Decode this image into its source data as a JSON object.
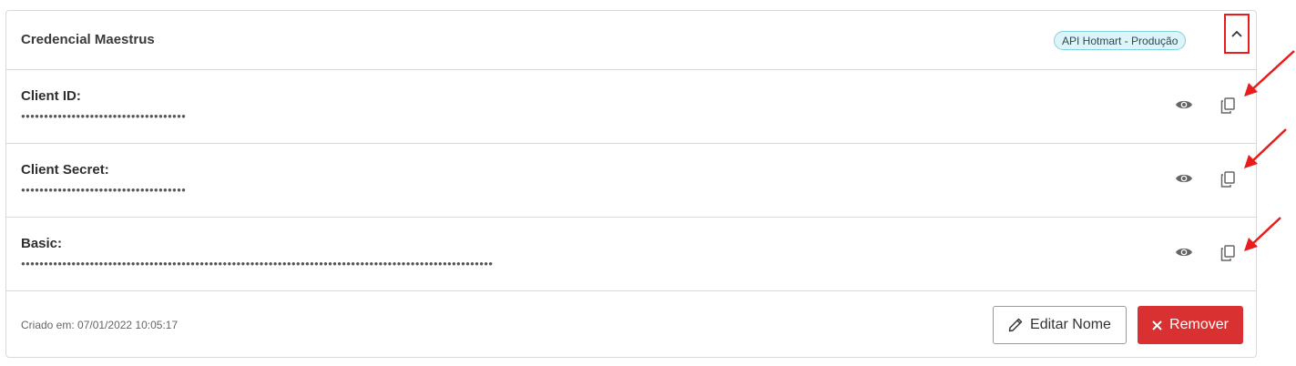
{
  "card": {
    "title": "Credencial Maestrus",
    "badge": "API Hotmart - Produção",
    "toggle_icon": "chevron-up-icon"
  },
  "fields": [
    {
      "label": "Client ID:",
      "value": "●●●●●●●●●●●●●●●●●●●●●●●●●●●●●●●●●●●●"
    },
    {
      "label": "Client Secret:",
      "value": "●●●●●●●●●●●●●●●●●●●●●●●●●●●●●●●●●●●●"
    },
    {
      "label": "Basic:",
      "value": "●●●●●●●●●●●●●●●●●●●●●●●●●●●●●●●●●●●●●●●●●●●●●●●●●●●●●●●●●●●●●●●●●●●●●●●●●●●●●●●●●●●●●●●●●●●●●●●●●●●●●●●"
    }
  ],
  "footer": {
    "created_label": "Criado em:",
    "created_value": "07/01/2022 10:05:17",
    "edit_label": "Editar Nome",
    "remove_label": "Remover"
  },
  "colors": {
    "annotation_red": "#e81c1c",
    "remove_button": "#d93131",
    "badge_bg": "#ddf4f8",
    "badge_border": "#7fd2e0"
  },
  "icons": [
    "chevron-up-icon",
    "eye-icon",
    "copy-icon",
    "pencil-icon",
    "close-icon",
    "annotation-arrow-icon"
  ]
}
